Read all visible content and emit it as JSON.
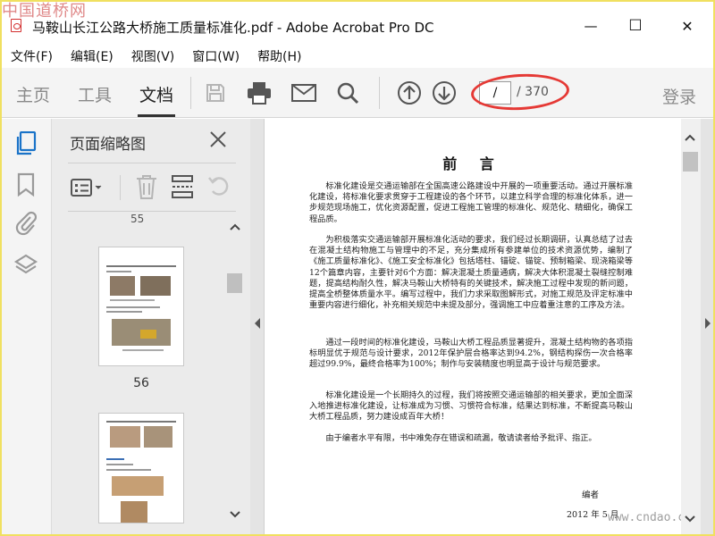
{
  "window": {
    "title": "马鞍山长江公路大桥施工质量标准化.pdf - Adobe Acrobat Pro DC",
    "watermark_top_left": "中国道桥网",
    "minimize_glyph": "—",
    "maximize_glyph": "☐",
    "close_glyph": "✕"
  },
  "menu": [
    "文件(F)",
    "编辑(E)",
    "视图(V)",
    "窗口(W)",
    "帮助(H)"
  ],
  "toolbar": {
    "tabs": [
      "主页",
      "工具",
      "文档"
    ],
    "active_tab": "文档",
    "icons": [
      "save-icon",
      "print-icon",
      "email-icon",
      "search-icon",
      "page-up-icon",
      "page-down-icon"
    ],
    "page_current": "/",
    "page_total": "/ 370",
    "login": "登录"
  },
  "rail_icons": [
    "pages-icon",
    "bookmark-icon",
    "attachment-icon",
    "layers-icon"
  ],
  "thumbnail_panel": {
    "title": "页面缩略图",
    "close_glyph": "✕",
    "tools": [
      "thumbnail-options-icon",
      "delete-page-icon",
      "insert-page-icon",
      "rotate-page-icon"
    ],
    "pages": [
      {
        "label": "56"
      }
    ],
    "top_page_label_partial": "55"
  },
  "document": {
    "heading": "前 言",
    "paragraphs": [
      "标准化建设是交通运输部在全国高速公路建设中开展的一项重要活动。通过开展标准化建设，将标准化要求贯穿于工程建设的各个环节，以建立科学合理的标准化体系，进一步规范现场施工，优化资源配置，促进工程施工管理的标准化、规范化、精细化，确保工程品质。",
      "为积极落实交通运输部开展标准化活动的要求，我们经过长期调研，认真总结了过去在混凝土结构物施工与管理中的不足，充分集成所有参建单位的技术资源优势，编制了《施工质量标准化》、《施工安全标准化》包括塔柱、锚碇、锚锭、预制箱梁、现浇箱梁等12个篇章内容，主要针对6个方面：解决混凝土质量通病，解决大体积混凝土裂缝控制难题，提高结构耐久性，解决马鞍山大桥特有的关键技术，解决施工过程中发现的新问题，提高全桥整体质量水平。编写过程中，我们力求采取图解形式，对施工规范及评定标准中重要内容进行细化，补充相关规范中未提及部分，强调施工中应着重注意的工序及方法。",
      "通过一段时间的标准化建设，马鞍山大桥工程品质显著提升，混凝土结构物的各项指标明显优于规范与设计要求，2012年保护层合格率达到94.2%，钢结构探伤一次合格率超过99.9%，最终合格率为100%；制作与安装精度也明显高于设计与规范要求。",
      "标准化建设是一个长期持久的过程，我们将按照交通运输部的相关要求，更加全面深入地推进标准化建设，让标准成为习惯、习惯符合标准，结果达到标准，不断提高马鞍山大桥工程品质，努力建设成百年大桥！",
      "由于编者水平有限，书中难免存在错误和疏漏，敬请读者给予批评、指正。"
    ],
    "signature": "编者",
    "date": "2012 年 5 月",
    "watermark_bottom_right": "www.cndao.com"
  },
  "colors": {
    "accent_red": "#e53935",
    "acrobat_red": "#d32f2f",
    "rail_active_blue": "#1a73c8"
  }
}
